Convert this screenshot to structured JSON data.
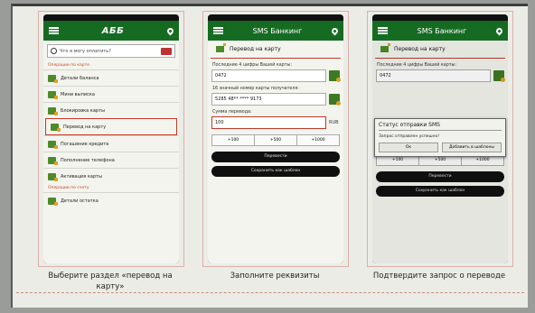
{
  "captions": {
    "step1": "Выберите раздел «перевод на карту»",
    "step2": "Заполните реквизиты",
    "step3": "Подтвердите запрос о переводе"
  },
  "screen1": {
    "logo": "АББ",
    "search_placeholder": "Что я могу оплатить?",
    "section1": "Операции по карте",
    "items": [
      "Детали баланса",
      "Мини выписка",
      "Блокировка карты",
      "Перевод на карту",
      "Погашение кредита",
      "Пополнение телефона",
      "Активация карты"
    ],
    "section2": "Операции по счету",
    "item_last": "Детали остатка"
  },
  "screen2": {
    "title": "SMS Банкинг",
    "subtitle": "Перевод на карту",
    "label_last4": "Последние 4 цифры Вашей карты:",
    "last4": "0472",
    "label_dest": "16 значный номер карты получателя:",
    "dest": "5285 48** **** 9173",
    "label_amount": "Сумма перевода:",
    "amount": "100",
    "currency": "RUB",
    "quick": [
      "+100",
      "+500",
      "+1000"
    ],
    "btn_transfer": "Перевести",
    "btn_save": "Сохранить как шаблон"
  },
  "screen3": {
    "title": "SMS Банкинг",
    "subtitle": "Перевод на карту",
    "label_last4": "Последние 4 цифры Вашей карты:",
    "last4": "0472",
    "dialog_title": "Статус отправки SMS",
    "dialog_text": "Запрос отправлен успешно!",
    "btn_ok": "Ок",
    "btn_template": "Добавить в шаблоны",
    "quick": [
      "+100",
      "+500",
      "+1000"
    ],
    "btn_transfer": "Перевести",
    "btn_save": "Сохранить как шаблон"
  }
}
